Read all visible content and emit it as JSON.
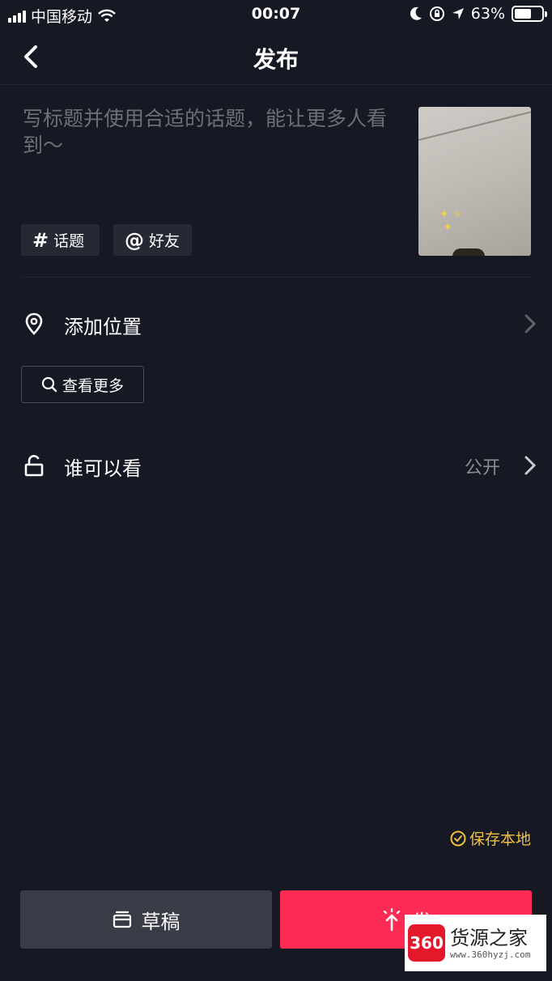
{
  "status_bar": {
    "carrier": "中国移动",
    "time": "00:07",
    "battery": "63%",
    "battery_level": 0.63
  },
  "nav": {
    "title": "发布",
    "back_icon": "chevron-left-icon"
  },
  "composer": {
    "caption_placeholder": "写标题并使用合适的话题，能让更多人看到～",
    "topic_chip": {
      "symbol": "#",
      "label": "话题"
    },
    "friend_chip": {
      "symbol": "@",
      "label": "好友"
    }
  },
  "location": {
    "label": "添加位置",
    "icon": "location-pin-icon",
    "see_more": "查看更多"
  },
  "privacy": {
    "label": "谁可以看",
    "value": "公开",
    "icon": "unlock-icon"
  },
  "save_local": {
    "label": "保存本地",
    "icon": "check-circle-icon"
  },
  "actions": {
    "draft_label": "草稿",
    "publish_label": "发"
  },
  "watermark": {
    "logo_text": "360",
    "title": "货源之家",
    "url": "www.360hyzj.com"
  },
  "colors": {
    "background": "#161824",
    "accent": "#fe2c55",
    "draft_button": "#393b46",
    "save_local": "#f0c03c",
    "muted_text": "#6d6f78"
  }
}
